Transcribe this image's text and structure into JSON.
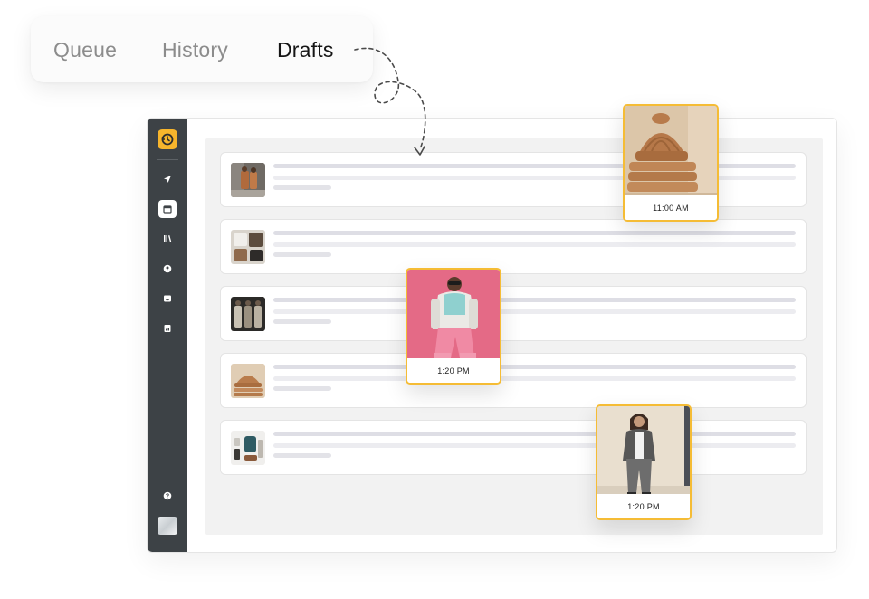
{
  "tabs": [
    {
      "label": "Queue",
      "active": false
    },
    {
      "label": "History",
      "active": false
    },
    {
      "label": "Drafts",
      "active": true
    }
  ],
  "sidebar": {
    "items": [
      {
        "icon": "send-icon"
      },
      {
        "icon": "calendar-icon",
        "active": true
      },
      {
        "icon": "library-icon"
      },
      {
        "icon": "user-icon"
      },
      {
        "icon": "inbox-icon"
      },
      {
        "icon": "analytics-icon"
      }
    ],
    "footer": [
      {
        "icon": "help-icon"
      },
      {
        "icon": "avatar"
      }
    ]
  },
  "posts": [
    {
      "thumbnail": "fashion-outfit-thumbnail"
    },
    {
      "thumbnail": "clothing-flatlay-thumbnail"
    },
    {
      "thumbnail": "group-models-thumbnail"
    },
    {
      "thumbnail": "knit-beanie-thumbnail"
    },
    {
      "thumbnail": "accessories-thumbnail"
    }
  ],
  "scheduled_cards": [
    {
      "time": "11:00 AM",
      "image": "knit-beanies-photo"
    },
    {
      "time": "1:20 PM",
      "image": "pink-model-photo"
    },
    {
      "time": "1:20 PM",
      "image": "grey-outfit-photo"
    }
  ],
  "colors": {
    "accent": "#f5bc35",
    "sidebar": "#3d4246",
    "content_bg": "#f2f2f2"
  }
}
